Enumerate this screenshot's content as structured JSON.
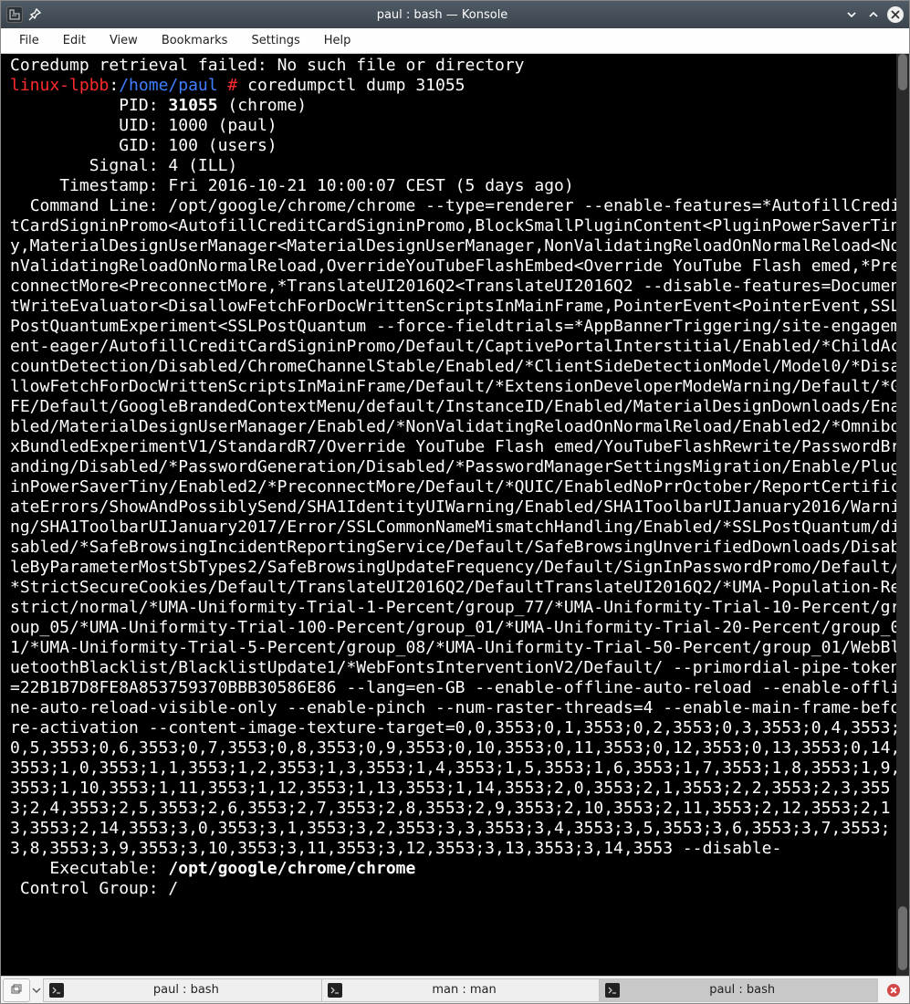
{
  "titlebar": {
    "title": "paul : bash — Konsole"
  },
  "menubar": {
    "items": [
      "File",
      "Edit",
      "View",
      "Bookmarks",
      "Settings",
      "Help"
    ]
  },
  "terminal": {
    "error_line": "Coredump retrieval failed: No such file or directory",
    "prompt_host": "linux-lpbb",
    "prompt_sep1": ":",
    "prompt_cwd": "/home/paul",
    "prompt_tail": " # ",
    "command": "coredumpctl dump 31055",
    "fields": {
      "pid_label": "           PID: ",
      "pid_value": "31055",
      "pid_tail": " (chrome)",
      "uid_label": "           UID: ",
      "uid_value": "1000 (paul)",
      "gid_label": "           GID: ",
      "gid_value": "100 (users)",
      "signal_label": "        Signal: ",
      "signal_value": "4 (ILL)",
      "ts_label": "     Timestamp: ",
      "ts_value": "Fri 2016-10-21 10:00:07 CEST (5 days ago)",
      "cmd_label": "  Command Line: ",
      "cmd_value": "/opt/google/chrome/chrome --type=renderer --enable-features=*AutofillCreditCardSigninPromo<AutofillCreditCardSigninPromo,BlockSmallPluginContent<PluginPowerSaverTiny,MaterialDesignUserManager<MaterialDesignUserManager,NonValidatingReloadOnNormalReload<NonValidatingReloadOnNormalReload,OverrideYouTubeFlashEmbed<Override YouTube Flash emed,*PreconnectMore<PreconnectMore,*TranslateUI2016Q2<TranslateUI2016Q2 --disable-features=DocumentWriteEvaluator<DisallowFetchForDocWrittenScriptsInMainFrame,PointerEvent<PointerEvent,SSLPostQuantumExperiment<SSLPostQuantum --force-fieldtrials=*AppBannerTriggering/site-engagement-eager/AutofillCreditCardSigninPromo/Default/CaptivePortalInterstitial/Enabled/*ChildAccountDetection/Disabled/ChromeChannelStable/Enabled/*ClientSideDetectionModel/Model0/*DisallowFetchForDocWrittenScriptsInMainFrame/Default/*ExtensionDeveloperModeWarning/Default/*GFE/Default/GoogleBrandedContextMenu/default/InstanceID/Enabled/MaterialDesignDownloads/Enabled/MaterialDesignUserManager/Enabled/*NonValidatingReloadOnNormalReload/Enabled2/*OmniboxBundledExperimentV1/StandardR7/Override YouTube Flash emed/YouTubeFlashRewrite/PasswordBranding/Disabled/*PasswordGeneration/Disabled/*PasswordManagerSettingsMigration/Enable/PluginPowerSaverTiny/Enabled2/*PreconnectMore/Default/*QUIC/EnabledNoPrrOctober/ReportCertificateErrors/ShowAndPossiblySend/SHA1IdentityUIWarning/Enabled/SHA1ToolbarUIJanuary2016/Warning/SHA1ToolbarUIJanuary2017/Error/SSLCommonNameMismatchHandling/Enabled/*SSLPostQuantum/disabled/*SafeBrowsingIncidentReportingService/Default/SafeBrowsingUnverifiedDownloads/DisableByParameterMostSbTypes2/SafeBrowsingUpdateFrequency/Default/SignInPasswordPromo/Default/*StrictSecureCookies/Default/TranslateUI2016Q2/DefaultTranslateUI2016Q2/*UMA-Population-Restrict/normal/*UMA-Uniformity-Trial-1-Percent/group_77/*UMA-Uniformity-Trial-10-Percent/group_05/*UMA-Uniformity-Trial-100-Percent/group_01/*UMA-Uniformity-Trial-20-Percent/group_01/*UMA-Uniformity-Trial-5-Percent/group_08/*UMA-Uniformity-Trial-50-Percent/group_01/WebBluetoothBlacklist/BlacklistUpdate1/*WebFontsInterventionV2/Default/ --primordial-pipe-token=22B1B7D8FE8A853759370BBB30586E86 --lang=en-GB --enable-offline-auto-reload --enable-offline-auto-reload-visible-only --enable-pinch --num-raster-threads=4 --enable-main-frame-before-activation --content-image-texture-target=0,0,3553;0,1,3553;0,2,3553;0,3,3553;0,4,3553;0,5,3553;0,6,3553;0,7,3553;0,8,3553;0,9,3553;0,10,3553;0,11,3553;0,12,3553;0,13,3553;0,14,3553;1,0,3553;1,1,3553;1,2,3553;1,3,3553;1,4,3553;1,5,3553;1,6,3553;1,7,3553;1,8,3553;1,9,3553;1,10,3553;1,11,3553;1,12,3553;1,13,3553;1,14,3553;2,0,3553;2,1,3553;2,2,3553;2,3,3553;2,4,3553;2,5,3553;2,6,3553;2,7,3553;2,8,3553;2,9,3553;2,10,3553;2,11,3553;2,12,3553;2,13,3553;2,14,3553;3,0,3553;3,1,3553;3,2,3553;3,3,3553;3,4,3553;3,5,3553;3,6,3553;3,7,3553;3,8,3553;3,9,3553;3,10,3553;3,11,3553;3,12,3553;3,13,3553;3,14,3553 --disable-",
      "exe_label": "    Executable: ",
      "exe_value": "/opt/google/chrome/chrome",
      "cg_label": " Control Group: ",
      "cg_value": "/"
    }
  },
  "tabs": {
    "items": [
      {
        "label": "paul : bash",
        "active": false
      },
      {
        "label": "man : man",
        "active": false
      },
      {
        "label": "paul : bash",
        "active": true
      }
    ]
  }
}
